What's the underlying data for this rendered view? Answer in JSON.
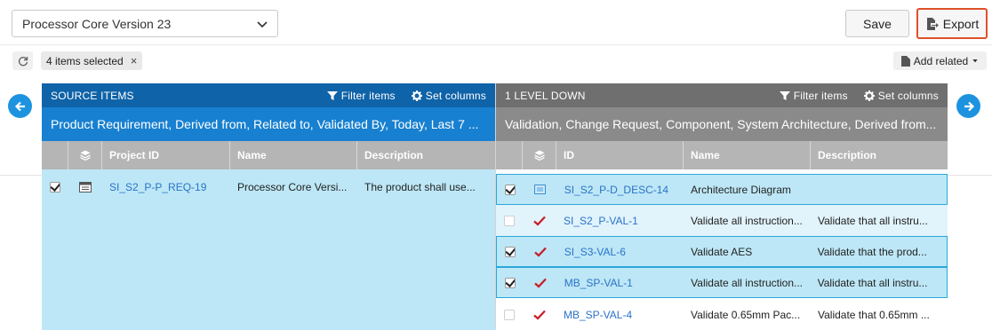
{
  "toolbar": {
    "version_select": "Processor Core Version 23",
    "save_label": "Save",
    "export_label": "Export",
    "chip_label": "4 items selected",
    "chip_close": "×",
    "add_related_label": "Add related"
  },
  "source_panel": {
    "title": "SOURCE ITEMS",
    "filter_label": "Filter items",
    "set_columns_label": "Set columns",
    "relations": "Product Requirement, Derived from, Related to, Validated By, Today, Last 7 ...",
    "columns": [
      "Project ID",
      "Name",
      "Description"
    ],
    "rows": [
      {
        "id": "SI_S2_P-P_REQ-19",
        "name": "Processor Core Versi...",
        "description": "The product shall use...",
        "checked": true,
        "icon": "requirement-icon"
      }
    ]
  },
  "down_panel": {
    "title": "1 LEVEL DOWN",
    "filter_label": "Filter items",
    "set_columns_label": "Set columns",
    "relations": "Validation, Change Request, Component, System Architecture, Derived from...",
    "columns": [
      "ID",
      "Name",
      "Description"
    ],
    "rows": [
      {
        "id": "SI_S2_P-D_DESC-14",
        "name": "Architecture Diagram",
        "description": "",
        "checked": true,
        "icon": "diagram-icon",
        "state": "selected"
      },
      {
        "id": "SI_S2_P-VAL-1",
        "name": "Validate all instruction...",
        "description": "Validate that all instru...",
        "checked": false,
        "icon": "validation-check-icon",
        "state": "light"
      },
      {
        "id": "SI_S3-VAL-6",
        "name": "Validate AES",
        "description": "Validate that the prod...",
        "checked": true,
        "icon": "validation-check-icon",
        "state": "selected"
      },
      {
        "id": "MB_SP-VAL-1",
        "name": "Validate all instruction...",
        "description": "Validate that all instru...",
        "checked": true,
        "icon": "validation-check-icon",
        "state": "selected"
      },
      {
        "id": "MB_SP-VAL-4",
        "name": "Validate 0.65mm Pac...",
        "description": "Validate that 0.65mm ...",
        "checked": false,
        "icon": "validation-check-icon",
        "state": "plain"
      }
    ]
  },
  "colors": {
    "source_header": "#0f63a8",
    "source_relations": "#1880d0",
    "down_header": "#6f6f6f",
    "down_relations": "#8a8a8a",
    "selected_row": "#bde7f6",
    "export_highlight": "#e0512b",
    "link": "#2a73c9",
    "validation_check": "#c8202a"
  }
}
